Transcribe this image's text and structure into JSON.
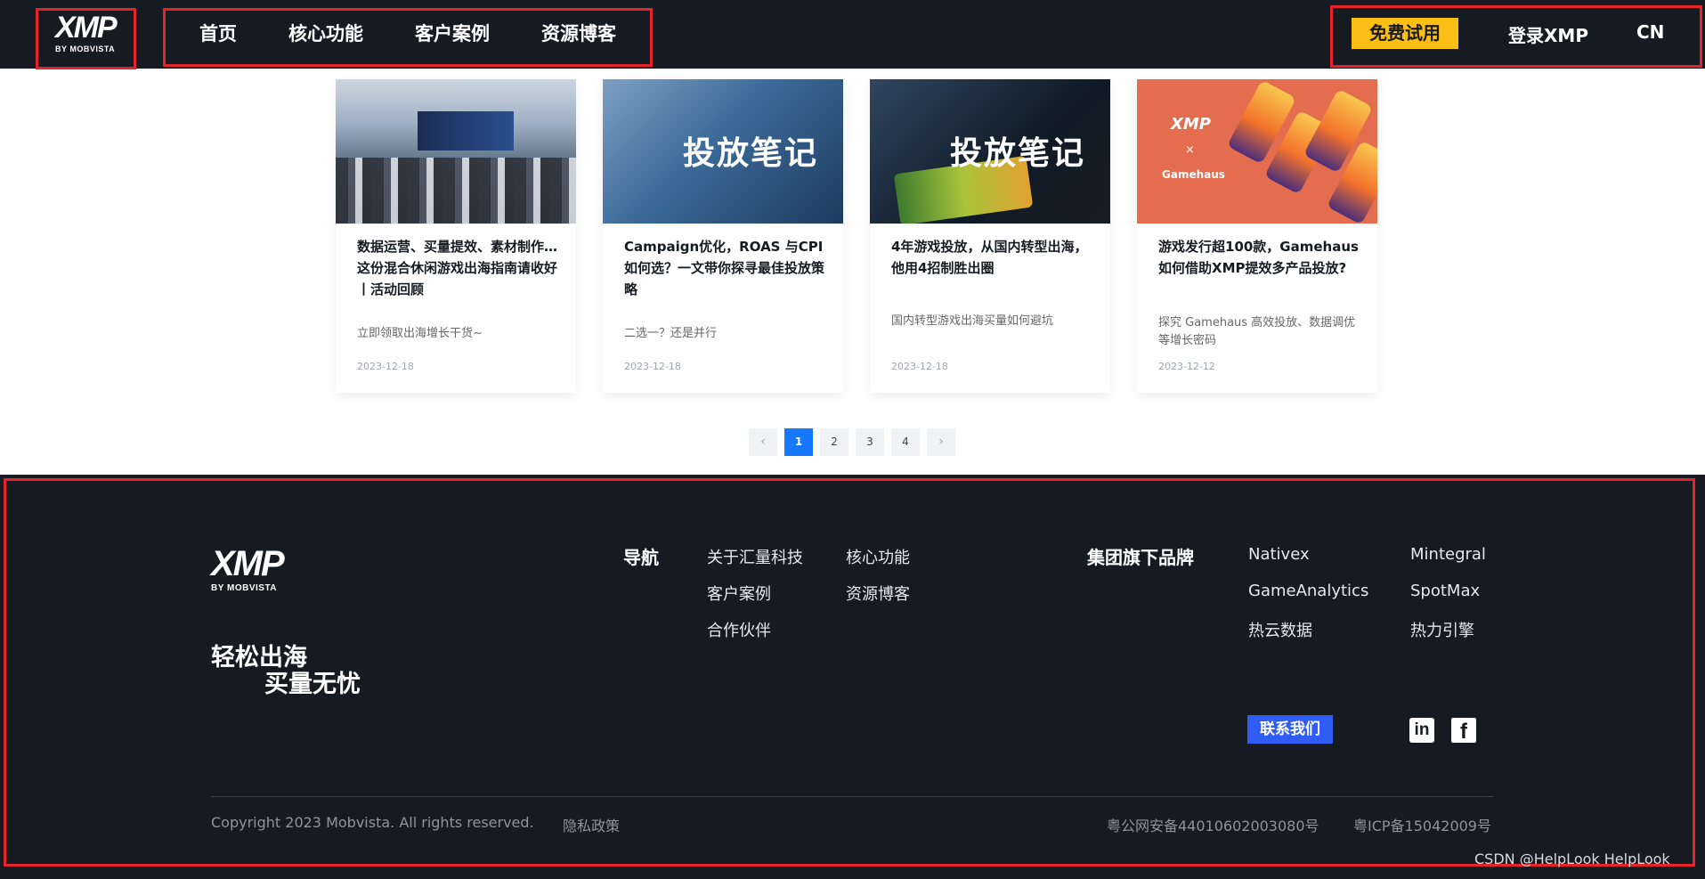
{
  "header": {
    "logo_mark": "XMP",
    "logo_sub": "BY MOBVISTA",
    "nav": [
      "首页",
      "核心功能",
      "客户案例",
      "资源博客"
    ],
    "trial_button": "免费试用",
    "login": "登录XMP",
    "lang": "CN"
  },
  "cards": [
    {
      "image_text": "",
      "title": "数据运营、买量提效、素材制作…这份混合休闲游戏出海指南请收好丨活动回顾",
      "desc": "立即领取出海增长干货~",
      "date": "2023-12-18"
    },
    {
      "image_text": "投放笔记",
      "title": "Campaign优化，ROAS 与CPI 如何选？一文带你探寻最佳投放策略",
      "desc": "二选一？还是并行",
      "date": "2023-12-18"
    },
    {
      "image_text": "投放笔记",
      "title": "4年游戏投放，从国内转型出海，他用4招制胜出圈",
      "desc": "国内转型游戏出海买量如何避坑",
      "date": "2023-12-18"
    },
    {
      "image_text": "Gamehaus",
      "title": "游戏发行超100款，Gamehaus如何借助XMP提效多产品投放?",
      "desc": "探究 Gamehaus 高效投放、数据调优等增长密码",
      "date": "2023-12-12"
    }
  ],
  "pagination": {
    "prev": "‹",
    "pages": [
      "1",
      "2",
      "3",
      "4"
    ],
    "active": "1",
    "next": "›"
  },
  "footer": {
    "logo_mark": "XMP",
    "logo_sub": "BY MOBVISTA",
    "slogan_line1": "轻松出海",
    "slogan_line2": "买量无忧",
    "nav_heading": "导航",
    "nav_links": [
      "关于汇量科技",
      "核心功能",
      "客户案例",
      "资源博客",
      "合作伙伴"
    ],
    "brands_heading": "集团旗下品牌",
    "brands": [
      "Nativex",
      "Mintegral",
      "GameAnalytics",
      "SpotMax",
      "热云数据",
      "热力引擎"
    ],
    "contact_button": "联系我们",
    "linkedin": "in",
    "facebook": "f",
    "copyright": "Copyright 2023 Mobvista. All rights reserved.",
    "privacy": "隐私政策",
    "gongan": "粤公网安备44010602003080号",
    "icp": "粤ICP备15042009号",
    "watermark": "CSDN @HelpLook HelpLook"
  },
  "colors": {
    "dark_bg": "#161b22",
    "accent_yellow": "#fbbf15",
    "accent_blue": "#1677ff",
    "contact_blue": "#2f5cf5",
    "highlight_red": "#e5232b"
  }
}
